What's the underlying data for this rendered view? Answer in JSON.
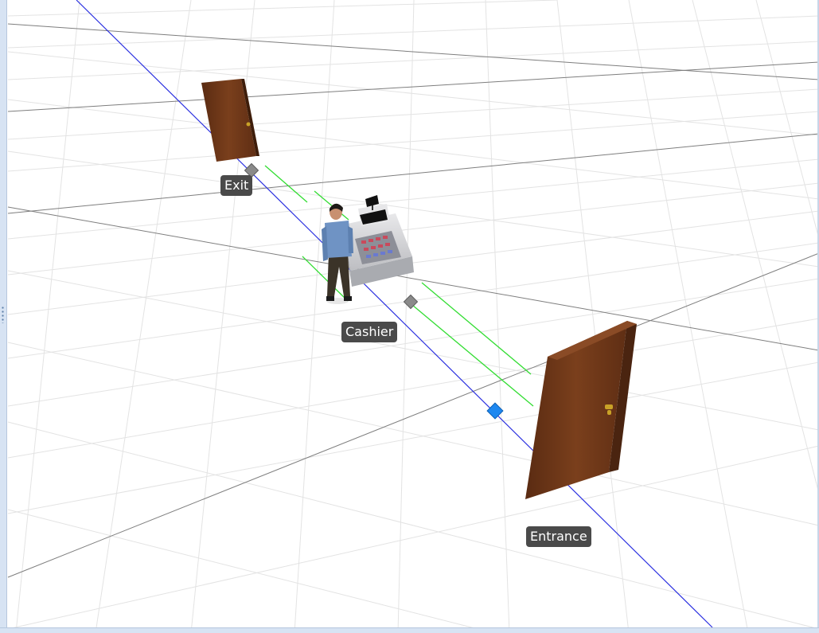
{
  "scene": {
    "objects": [
      {
        "id": "exit",
        "label": "Exit",
        "type": "door"
      },
      {
        "id": "cashier",
        "label": "Cashier",
        "type": "cash-register"
      },
      {
        "id": "entrance",
        "label": "Entrance",
        "type": "door"
      }
    ],
    "colors": {
      "path": "#2a2fe0",
      "queue_lines": "#33dd33",
      "grid_minor": "#e3e3e3",
      "grid_major": "#7e7e7e",
      "door": "#6b3517",
      "label_bg": "#4a4a4a",
      "selected_node": "#1e88f0",
      "node": "#8a8a8a"
    }
  }
}
